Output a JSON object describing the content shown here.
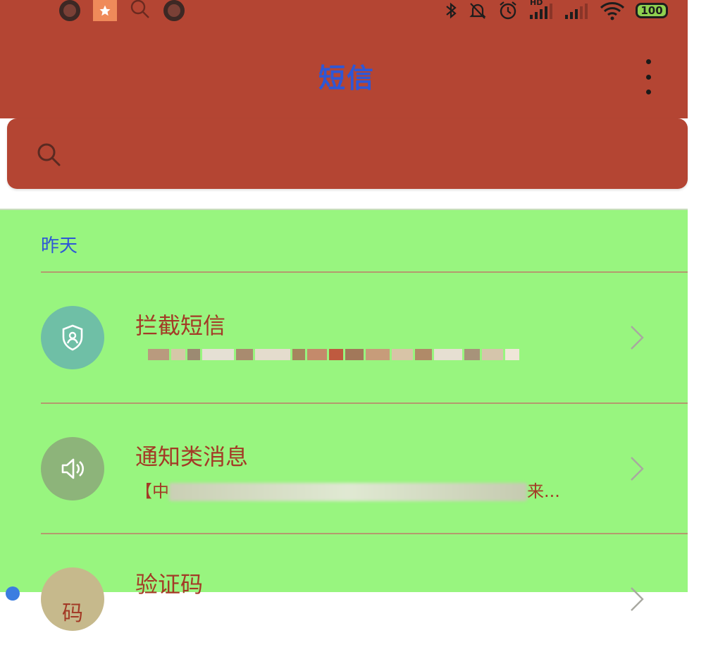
{
  "status_bar": {
    "battery_level": "100",
    "icons": [
      "ring-icon",
      "star-icon",
      "search-small-icon",
      "ring-icon",
      "bluetooth-icon",
      "mute-bell-icon",
      "alarm-icon",
      "signal-hd-icon",
      "signal-icon",
      "wifi-icon",
      "battery-icon"
    ],
    "signal_label": "HD"
  },
  "header": {
    "title": "短信",
    "background": "#b44533",
    "title_color": "#2e57d6"
  },
  "search": {
    "placeholder": ""
  },
  "list": {
    "background": "#98f57f",
    "section_label": "昨天",
    "items": [
      {
        "title": "拦截短信",
        "subtitle": "",
        "icon": "shield-user-icon",
        "icon_color": "#6fbfa6"
      },
      {
        "title": "通知类消息",
        "subtitle_prefix": "【中",
        "subtitle_suffix": "来...",
        "icon": "speaker-icon",
        "icon_color": "#8db47a"
      },
      {
        "title": "验证码",
        "icon_text": "码",
        "icon": "code-badge-icon",
        "icon_color": "#c6b98c"
      }
    ]
  }
}
